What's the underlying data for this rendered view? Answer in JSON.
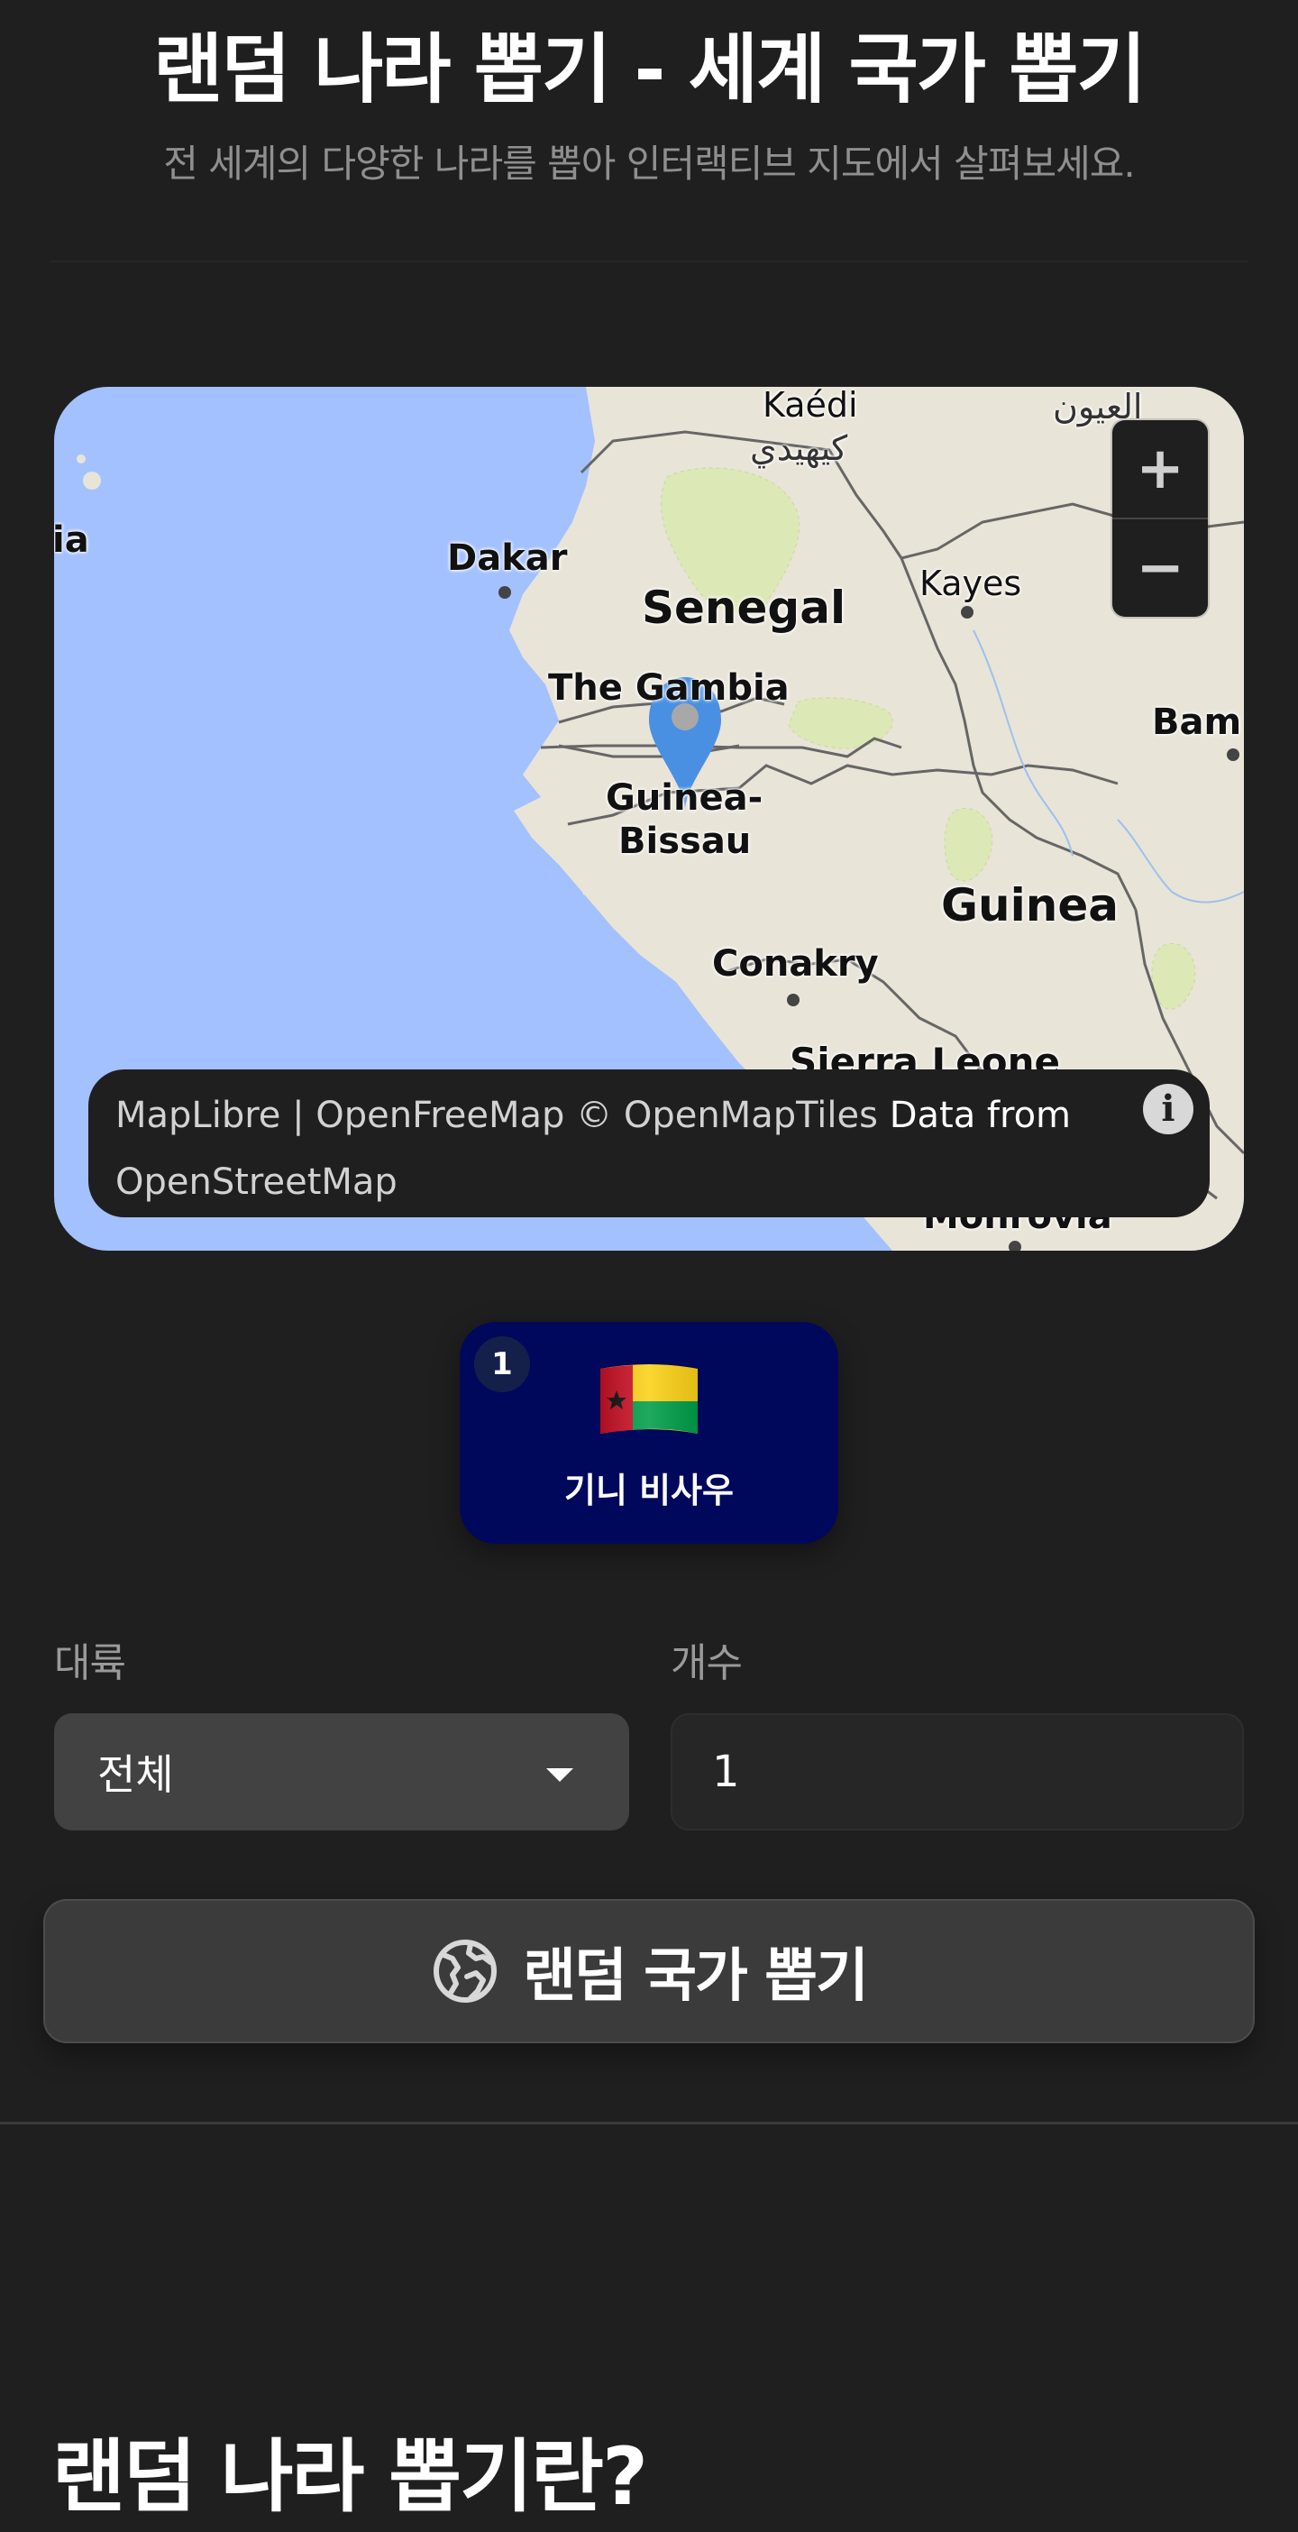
{
  "header": {
    "title": "랜덤 나라 뽑기 - 세계 국가 뽑기",
    "subtitle": "전 세계의 다양한 나라를 뽑아 인터랙티브 지도에서 살펴보세요."
  },
  "map": {
    "labels": {
      "kaedi": "Kaédi",
      "kaedi_script": "كيهيدي",
      "top_right_script": "العيون",
      "left_edge": "ia",
      "dakar": "Dakar",
      "senegal": "Senegal",
      "kayes": "Kayes",
      "gambia": "The Gambia",
      "bamako": "Bam",
      "guinea_bissau_1": "Guinea-",
      "guinea_bissau_2": "Bissau",
      "guinea": "Guinea",
      "conakry": "Conakry",
      "sierra_leone": "Sierra Leone",
      "monrovia": "Monrovia"
    },
    "zoom_in": "+",
    "zoom_out": "−",
    "attribution": {
      "part1": "MapLibre | OpenFreeMap © OpenMapTiles",
      "part2": "Data from",
      "part3": "OpenStreetMap",
      "info": "i"
    },
    "colors": {
      "water": "#a3c1fe",
      "land": "#e8e4d7",
      "parks": "#dde8b7",
      "marker": "#4a90e2"
    }
  },
  "result": {
    "index": "1",
    "flag_icon": "guinea-bissau-flag",
    "country_name": "기니 비사우",
    "card_color": "#00085c"
  },
  "form": {
    "continent_label": "대륙",
    "continent_value": "전체",
    "count_label": "개수",
    "count_value": "1"
  },
  "action": {
    "button_label": "랜덤 국가 뽑기",
    "icon": "globe-icon"
  },
  "section": {
    "title": "랜덤 나라 뽑기란?"
  }
}
